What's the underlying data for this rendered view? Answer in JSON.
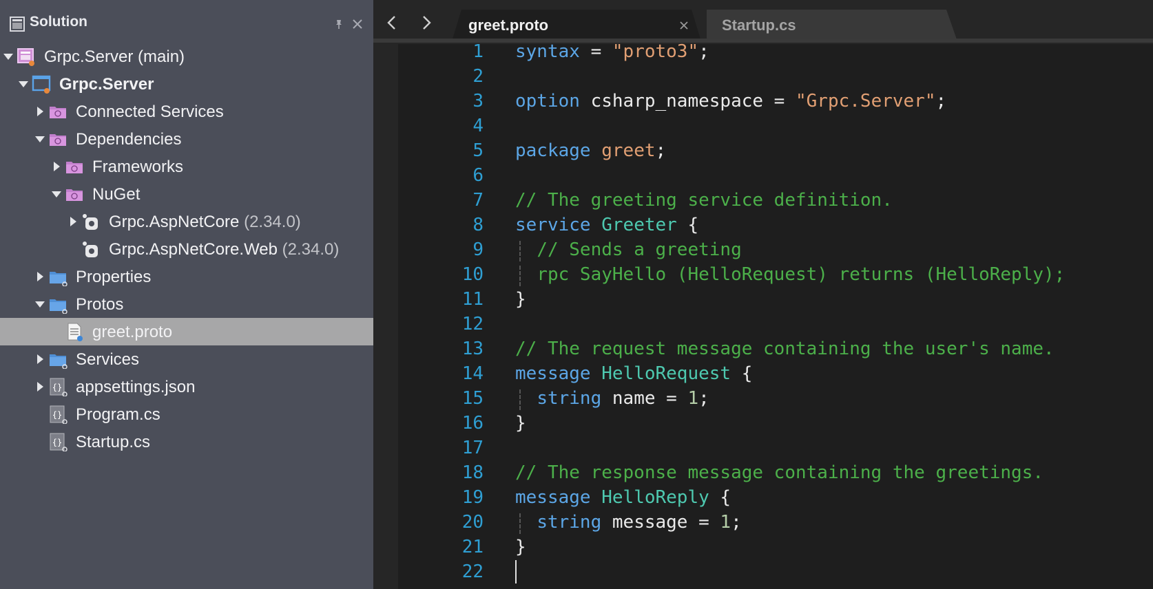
{
  "sidebar": {
    "title": "Solution",
    "pin_icon": "pin-icon",
    "close_icon": "close-icon",
    "tree": [
      {
        "label": "Grpc.Server (main)",
        "version": "",
        "icon": "solution-icon",
        "expanded": true
      },
      {
        "label": "Grpc.Server",
        "version": "",
        "icon": "project-icon",
        "expanded": true
      },
      {
        "label": "Connected Services",
        "version": "",
        "icon": "connected-services-folder-icon",
        "expanded": false
      },
      {
        "label": "Dependencies",
        "version": "",
        "icon": "dependencies-folder-icon",
        "expanded": true
      },
      {
        "label": "Frameworks",
        "version": "",
        "icon": "frameworks-folder-icon",
        "expanded": false
      },
      {
        "label": "NuGet",
        "version": "",
        "icon": "nuget-folder-icon",
        "expanded": true
      },
      {
        "label": "Grpc.AspNetCore",
        "version": "(2.34.0)",
        "icon": "package-icon",
        "expanded": false
      },
      {
        "label": "Grpc.AspNetCore.Web",
        "version": "(2.34.0)",
        "icon": "package-icon",
        "expanded": null
      },
      {
        "label": "Properties",
        "version": "",
        "icon": "folder-icon",
        "expanded": false
      },
      {
        "label": "Protos",
        "version": "",
        "icon": "folder-icon",
        "expanded": true
      },
      {
        "label": "greet.proto",
        "version": "",
        "icon": "proto-file-icon",
        "expanded": null,
        "selected": true
      },
      {
        "label": "Services",
        "version": "",
        "icon": "folder-icon",
        "expanded": false
      },
      {
        "label": "appsettings.json",
        "version": "",
        "icon": "json-file-icon",
        "expanded": false
      },
      {
        "label": "Program.cs",
        "version": "",
        "icon": "cs-file-icon",
        "expanded": null
      },
      {
        "label": "Startup.cs",
        "version": "",
        "icon": "cs-file-icon",
        "expanded": null
      }
    ]
  },
  "editor": {
    "tabs": [
      {
        "label": "greet.proto",
        "active": true
      },
      {
        "label": "Startup.cs",
        "active": false
      }
    ],
    "lines": [
      {
        "n": "1",
        "tokens": [
          [
            "kw",
            "syntax"
          ],
          [
            "p",
            " = "
          ],
          [
            "str",
            "\"proto3\""
          ],
          [
            "p",
            ";"
          ]
        ]
      },
      {
        "n": "2",
        "tokens": []
      },
      {
        "n": "3",
        "tokens": [
          [
            "kw",
            "option"
          ],
          [
            "p",
            " csharp_namespace = "
          ],
          [
            "str",
            "\"Grpc.Server\""
          ],
          [
            "p",
            ";"
          ]
        ]
      },
      {
        "n": "4",
        "tokens": []
      },
      {
        "n": "5",
        "tokens": [
          [
            "kw",
            "package"
          ],
          [
            "p",
            " "
          ],
          [
            "str",
            "greet"
          ],
          [
            "p",
            ";"
          ]
        ]
      },
      {
        "n": "6",
        "tokens": []
      },
      {
        "n": "7",
        "tokens": [
          [
            "cm",
            "// The greeting service definition."
          ]
        ]
      },
      {
        "n": "8",
        "tokens": [
          [
            "kw",
            "service"
          ],
          [
            "p",
            " "
          ],
          [
            "ty",
            "Greeter"
          ],
          [
            "p",
            " {"
          ]
        ]
      },
      {
        "n": "9",
        "tokens": [
          [
            "p",
            "  "
          ],
          [
            "cm",
            "// Sends a greeting"
          ]
        ],
        "guide": true
      },
      {
        "n": "10",
        "tokens": [
          [
            "p",
            "  "
          ],
          [
            "cm",
            "rpc SayHello (HelloRequest) returns (HelloReply);"
          ]
        ],
        "guide": true
      },
      {
        "n": "11",
        "tokens": [
          [
            "p",
            "}"
          ]
        ]
      },
      {
        "n": "12",
        "tokens": []
      },
      {
        "n": "13",
        "tokens": [
          [
            "cm",
            "// The request message containing the user's name."
          ]
        ]
      },
      {
        "n": "14",
        "tokens": [
          [
            "kw",
            "message"
          ],
          [
            "p",
            " "
          ],
          [
            "ty",
            "HelloRequest"
          ],
          [
            "p",
            " {"
          ]
        ]
      },
      {
        "n": "15",
        "tokens": [
          [
            "p",
            "  "
          ],
          [
            "kw",
            "string"
          ],
          [
            "p",
            " name = "
          ],
          [
            "num",
            "1"
          ],
          [
            "p",
            ";"
          ]
        ],
        "guide": true
      },
      {
        "n": "16",
        "tokens": [
          [
            "p",
            "}"
          ]
        ]
      },
      {
        "n": "17",
        "tokens": []
      },
      {
        "n": "18",
        "tokens": [
          [
            "cm",
            "// The response message containing the greetings."
          ]
        ]
      },
      {
        "n": "19",
        "tokens": [
          [
            "kw",
            "message"
          ],
          [
            "p",
            " "
          ],
          [
            "ty",
            "HelloReply"
          ],
          [
            "p",
            " {"
          ]
        ]
      },
      {
        "n": "20",
        "tokens": [
          [
            "p",
            "  "
          ],
          [
            "kw",
            "string"
          ],
          [
            "p",
            " message = "
          ],
          [
            "num",
            "1"
          ],
          [
            "p",
            ";"
          ]
        ],
        "guide": true
      },
      {
        "n": "21",
        "tokens": [
          [
            "p",
            "}"
          ]
        ]
      },
      {
        "n": "22",
        "tokens": [],
        "caret": true
      }
    ]
  },
  "colors": {
    "sidebar_bg": "#4b4e59",
    "selected_row": "#a7a7a8",
    "editor_bg": "#1e1e1e",
    "line_number": "#2f9fd3",
    "keyword": "#5ca6e6",
    "string": "#e19f73",
    "type": "#4ec9b0",
    "comment": "#4cb04a"
  }
}
